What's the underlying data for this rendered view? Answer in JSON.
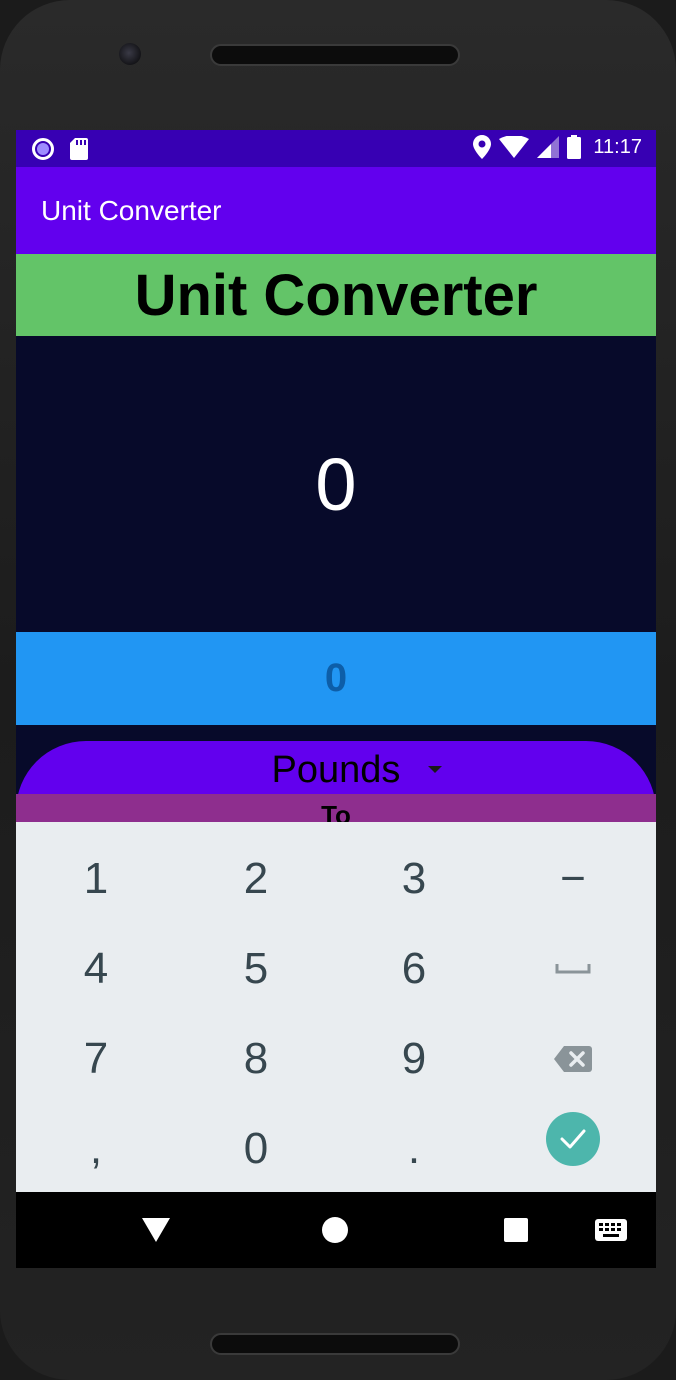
{
  "status_bar": {
    "time": "11:17",
    "icons": [
      "screen-record-icon",
      "sd-card-icon",
      "location-icon",
      "wifi-icon",
      "signal-icon",
      "battery-icon"
    ]
  },
  "app_bar": {
    "title": "Unit Converter"
  },
  "heading": {
    "text": "Unit Converter"
  },
  "display": {
    "value": "0"
  },
  "input": {
    "value": "0"
  },
  "unit_spinner": {
    "selected": "Pounds"
  },
  "to_label": "To",
  "keyboard": {
    "rows": [
      [
        "1",
        "2",
        "3",
        "−"
      ],
      [
        "4",
        "5",
        "6",
        "space"
      ],
      [
        "7",
        "8",
        "9",
        "backspace"
      ],
      [
        ",",
        "0",
        ".",
        "done"
      ]
    ]
  },
  "nav_bar": {
    "buttons": [
      "back-icon",
      "home-icon",
      "recents-icon",
      "keyboard-switch-icon"
    ]
  },
  "colors": {
    "status_bar": "#3700b3",
    "app_bar": "#6200ee",
    "heading_band": "#63c468",
    "display_bg": "#070a2a",
    "input_band": "#2196f3",
    "input_text": "#0d5ea8",
    "to_band": "#8e2e8e",
    "keyboard_bg": "#e9edf0",
    "key_text": "#37474f",
    "enter_button": "#4db6ac"
  }
}
